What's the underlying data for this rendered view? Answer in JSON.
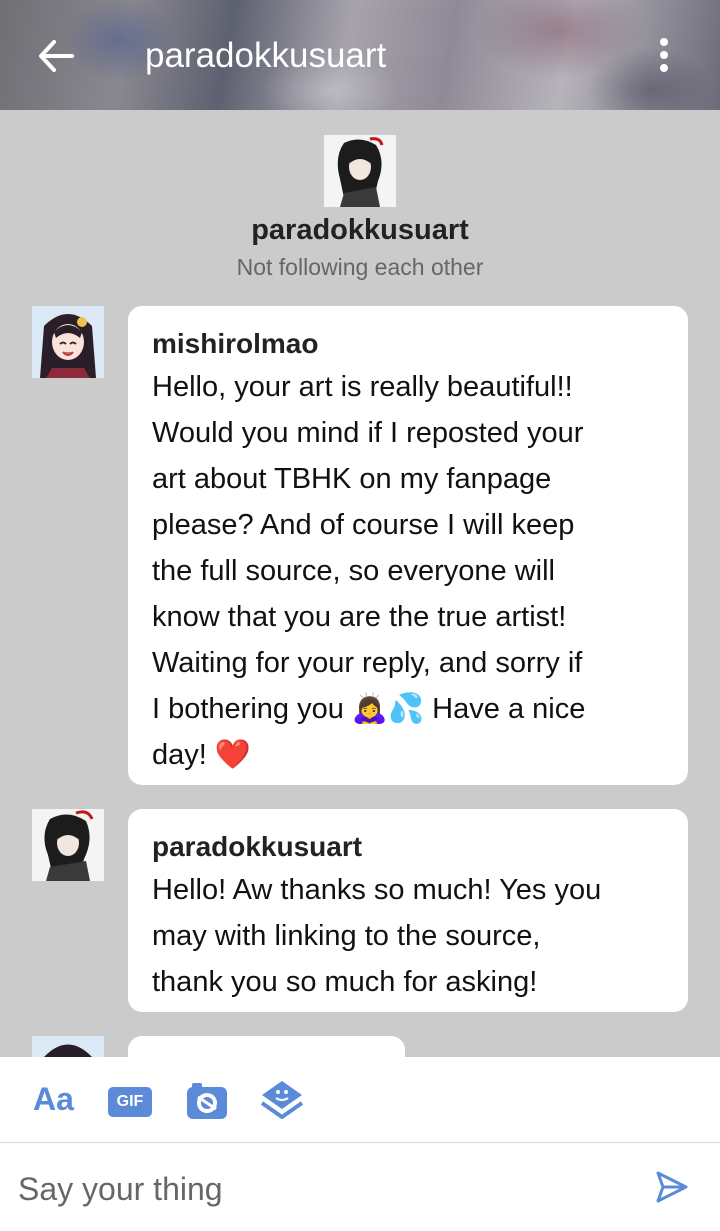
{
  "header": {
    "title": "paradokkusuart",
    "back_icon": "arrow-left-icon",
    "more_icon": "more-vertical-icon"
  },
  "profile": {
    "name": "paradokkusuart",
    "status": "Not following each other"
  },
  "messages": [
    {
      "sender": "mishirolmao",
      "lines": [
        "Hello, your art is really beautiful!!",
        "Would you mind if I reposted your",
        "art about TBHK on my fanpage",
        "please? And of course I will keep",
        "the full source, so everyone will",
        "know that you are the true artist!",
        "Waiting for your reply, and sorry if",
        "I bothering you 🙇‍♀️💦 Have a nice",
        "day! ❤️"
      ]
    },
    {
      "sender": "paradokkusuart",
      "lines": [
        "Hello! Aw thanks so much! Yes you",
        "may with linking to the source,",
        "thank you so much for asking!"
      ]
    }
  ],
  "toolbar": {
    "text_format_label": "Aa",
    "gif_label": "GIF",
    "camera_icon": "camera-icon",
    "sticker_icon": "sticker-icon"
  },
  "composer": {
    "placeholder": "Say your thing",
    "send_icon": "send-icon"
  },
  "colors": {
    "background": "#cbcbcb",
    "accent": "#5b8ad8"
  }
}
